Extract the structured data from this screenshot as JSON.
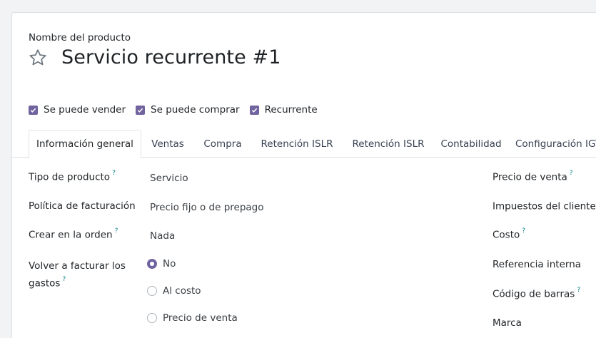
{
  "product": {
    "name_label": "Nombre del producto",
    "title": "Servicio recurrente #1"
  },
  "checkboxes": [
    {
      "label": "Se puede vender",
      "checked": true
    },
    {
      "label": "Se puede comprar",
      "checked": true
    },
    {
      "label": "Recurrente",
      "checked": true
    }
  ],
  "tabs": [
    {
      "label": "Información general",
      "active": true
    },
    {
      "label": "Ventas"
    },
    {
      "label": "Compra"
    },
    {
      "label": "Retención ISLR"
    },
    {
      "label": "Retención ISLR"
    },
    {
      "label": "Contabilidad"
    },
    {
      "label": "Configuración IGT"
    }
  ],
  "left_fields": [
    {
      "label": "Tipo de producto",
      "help": "?",
      "value": "Servicio"
    },
    {
      "label": "Política de facturación",
      "value": "Precio fijo o de prepago"
    },
    {
      "label": "Crear en la orden",
      "help": "?",
      "value": "Nada"
    },
    {
      "label_line1": "Volver a facturar los",
      "label_line2": "gastos",
      "help": "?"
    }
  ],
  "reinvoice_options": [
    {
      "label": "No",
      "selected": true
    },
    {
      "label": "Al costo",
      "selected": false
    },
    {
      "label": "Precio de venta",
      "selected": false
    }
  ],
  "right_fields": [
    {
      "label": "Precio de venta",
      "help": "?"
    },
    {
      "label": "Impuestos del cliente",
      "help": "?"
    },
    {
      "label": "Costo",
      "help": "?"
    },
    {
      "label": "Referencia interna"
    },
    {
      "label": "Código de barras",
      "help": "?"
    },
    {
      "label": "Marca"
    }
  ],
  "colors": {
    "accent": "#71639e",
    "help": "#017e84"
  }
}
